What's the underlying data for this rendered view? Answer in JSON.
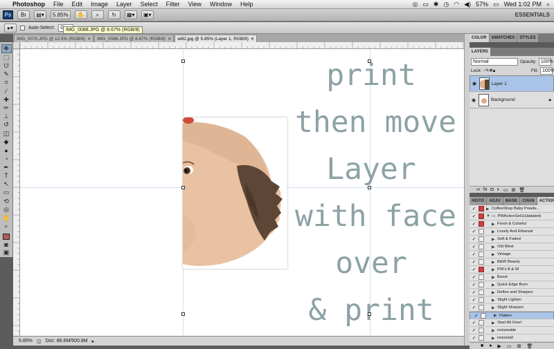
{
  "menubar": {
    "app_name": "Photoshop",
    "items": [
      "File",
      "Edit",
      "Image",
      "Layer",
      "Select",
      "Filter",
      "View",
      "Window",
      "Help"
    ],
    "battery": "57%",
    "clock": "Wed 1:02 PM"
  },
  "appbar": {
    "logo": "Ps",
    "zoom": "5.85%",
    "workspace": "ESSENTIALS"
  },
  "options": {
    "auto_select_label": "Auto-Select:",
    "auto_select_value": "Grou"
  },
  "tooltip": "IMG_0088.JPG @ 8.67% (RGB/8)",
  "doc_tabs": [
    {
      "label": "IMG_0070.JPG @ 12.5% (RGB/8)"
    },
    {
      "label": "IMG_0088.JPG @ 8.67% (RGB/8)"
    },
    {
      "label": "will2.jpg @ 5.85% (Layer 1, RGB/8)"
    }
  ],
  "canvas_text": [
    "print",
    "then move",
    "Layer",
    "with face",
    "over",
    "& print"
  ],
  "statusbar": {
    "zoom": "5.85%",
    "doc_info": "Doc: 86.6M/500.8M"
  },
  "panels": {
    "top_tabs": [
      "COLOR",
      "SWATCHES",
      "STYLES"
    ],
    "layers_tab": "LAYERS",
    "blend_mode": "Normal",
    "opacity_label": "Opacity:",
    "opacity_value": "100%",
    "lock_label": "Lock:",
    "fill_label": "Fill:",
    "fill_value": "100%",
    "layers": [
      {
        "name": "Layer 1",
        "selected": true
      },
      {
        "name": "Background",
        "selected": false
      }
    ],
    "actions_tabs": [
      "HISTO",
      "ADJU",
      "MASK",
      "CHAN",
      "ACTIONS"
    ],
    "actions": [
      {
        "name": "CoffeeShop Baby Powde...",
        "red": true,
        "folder": false
      },
      {
        "name": "PWActionSet1(Updated)",
        "red": true,
        "folder": true
      },
      {
        "name": "Fresh & Colorful",
        "red": true,
        "folder": false
      },
      {
        "name": "Lovely And Ethereal",
        "red": false,
        "folder": false
      },
      {
        "name": "Soft & Faded",
        "red": false,
        "folder": false
      },
      {
        "name": "Old West",
        "red": false,
        "folder": false
      },
      {
        "name": "Vintage",
        "red": false,
        "folder": false
      },
      {
        "name": "B&W Beauty",
        "red": false,
        "folder": false
      },
      {
        "name": "PW's B & W",
        "red": true,
        "folder": false
      },
      {
        "name": "Boost",
        "red": false,
        "folder": false
      },
      {
        "name": "Quick Edge Burn",
        "red": false,
        "folder": false
      },
      {
        "name": "Define and Sharpen",
        "red": false,
        "folder": false
      },
      {
        "name": "Slight Lighten",
        "red": false,
        "folder": false
      },
      {
        "name": "Slight Sharpen",
        "red": false,
        "folder": false
      },
      {
        "name": "Flatten",
        "red": false,
        "folder": false,
        "selected": true
      },
      {
        "name": "Start All Over!",
        "red": false,
        "folder": false
      },
      {
        "name": "resizewide",
        "red": false,
        "folder": false
      },
      {
        "name": "resizetall",
        "red": false,
        "folder": false
      }
    ]
  }
}
